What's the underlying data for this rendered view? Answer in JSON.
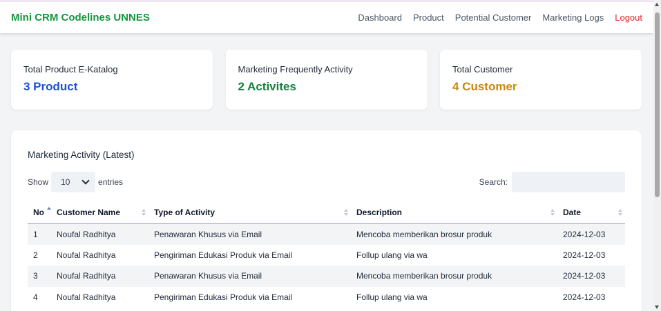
{
  "navbar": {
    "brand": "Mini CRM Codelines UNNES",
    "links": [
      "Dashboard",
      "Product",
      "Potential Customer",
      "Marketing Logs"
    ],
    "logout": "Logout"
  },
  "stats": [
    {
      "label": "Total Product E-Katalog",
      "value": "3 Product",
      "color": "#1d4ed8"
    },
    {
      "label": "Marketing Frequently Activity",
      "value": "2 Activites",
      "color": "#15803d"
    },
    {
      "label": "Total Customer",
      "value": "4 Customer",
      "color": "#ca8a04"
    }
  ],
  "panel": {
    "title": "Marketing Activity (Latest)",
    "show_label": "Show",
    "entries_value": "10",
    "entries_label": "entries",
    "search_label": "Search:",
    "search_value": ""
  },
  "table": {
    "headers": [
      "No",
      "Customer Name",
      "Type of Activity",
      "Description",
      "Date"
    ],
    "rows": [
      [
        "1",
        "Noufal Radhitya",
        "Penawaran Khusus via Email",
        "Mencoba memberikan brosur produk",
        "2024-12-03"
      ],
      [
        "2",
        "Noufal Radhitya",
        "Pengiriman Edukasi Produk via Email",
        "Follup ulang via wa",
        "2024-12-03"
      ],
      [
        "3",
        "Noufal Radhitya",
        "Penawaran Khusus via Email",
        "Mencoba memberikan brosur produk",
        "2024-12-03"
      ],
      [
        "4",
        "Noufal Radhitya",
        "Pengiriman Edukasi Produk via Email",
        "Follup ulang via wa",
        "2024-12-03"
      ]
    ]
  }
}
